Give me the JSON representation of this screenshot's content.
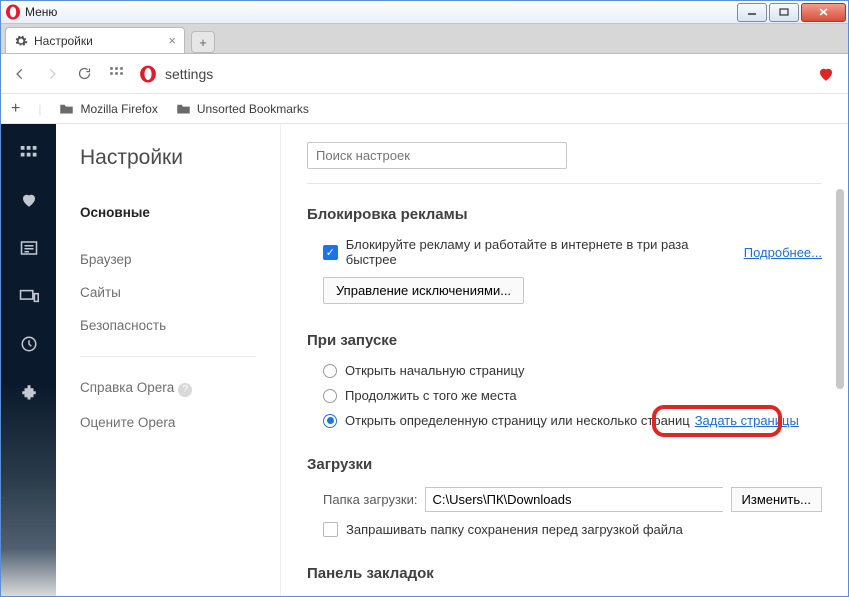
{
  "window": {
    "menu": "Меню"
  },
  "tab": {
    "title": "Настройки"
  },
  "address": {
    "value": "settings"
  },
  "bookmarks_bar": {
    "item1": "Mozilla Firefox",
    "item2": "Unsorted Bookmarks"
  },
  "settings_nav": {
    "title": "Настройки",
    "basic": "Основные",
    "browser": "Браузер",
    "sites": "Сайты",
    "security": "Безопасность",
    "help": "Справка Opera",
    "rate": "Оцените Opera"
  },
  "search": {
    "placeholder": "Поиск настроек"
  },
  "adblock": {
    "heading": "Блокировка рекламы",
    "check_label": "Блокируйте рекламу и работайте в интернете в три раза быстрее",
    "learn_more": "Подробнее...",
    "manage": "Управление исключениями..."
  },
  "startup": {
    "heading": "При запуске",
    "opt1": "Открыть начальную страницу",
    "opt2": "Продолжить с того же места",
    "opt3": "Открыть определенную страницу или несколько страниц",
    "set_pages": "Задать страницы"
  },
  "downloads": {
    "heading": "Загрузки",
    "folder_label": "Папка загрузки:",
    "folder_value": "C:\\Users\\ПК\\Downloads",
    "change": "Изменить...",
    "ask": "Запрашивать папку сохранения перед загрузкой файла"
  },
  "bookmarks_panel": {
    "heading": "Панель закладок"
  }
}
